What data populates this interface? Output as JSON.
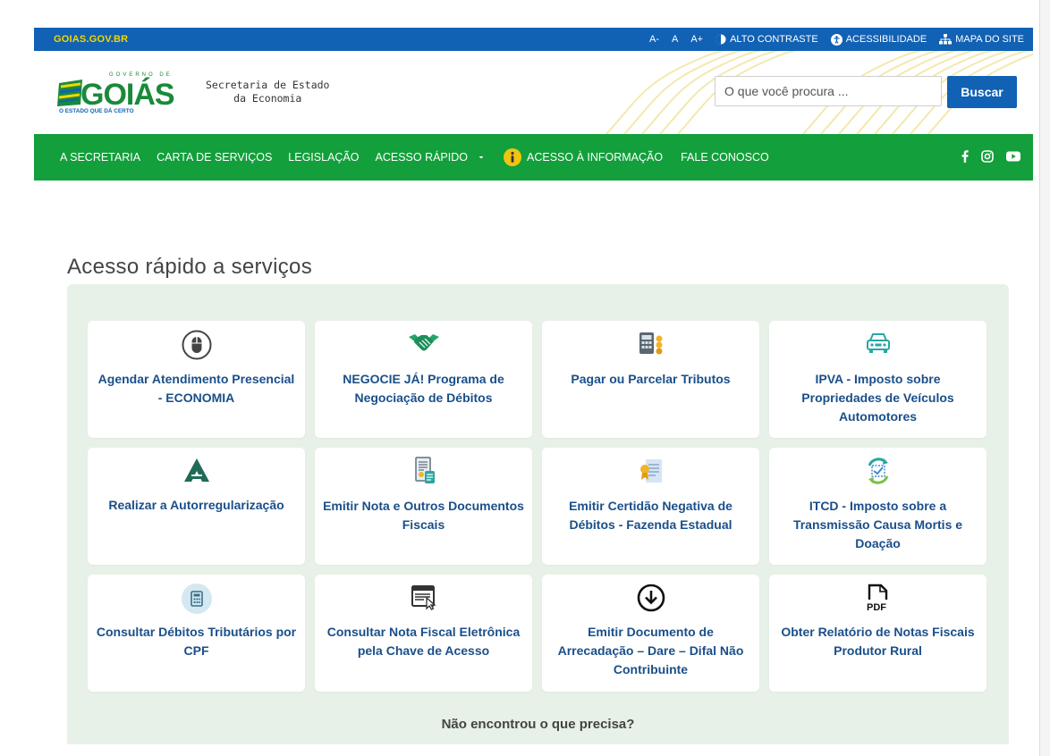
{
  "topbar": {
    "site": "GOIAS.GOV.BR",
    "font_decrease": "A-",
    "font_normal": "A",
    "font_increase": "A+",
    "contrast": "ALTO CONTRASTE",
    "accessibility": "ACESSIBILIDADE",
    "sitemap": "MAPA DO SITE"
  },
  "header": {
    "logo_top": "GOVERNO DE",
    "logo_main": "GOIÁS",
    "logo_tagline": "O ESTADO QUE DÁ CERTO",
    "secretaria_line1": "Secretaria de Estado",
    "secretaria_line2": "da Economia",
    "search_placeholder": "O que você procura ...",
    "search_button": "Buscar"
  },
  "nav": {
    "items": [
      {
        "label": "A SECRETARIA"
      },
      {
        "label": "CARTA DE SERVIÇOS"
      },
      {
        "label": "LEGISLAÇÃO"
      },
      {
        "label": "ACESSO RÁPIDO"
      },
      {
        "label": "ACESSO À INFORMAÇÃO"
      },
      {
        "label": "FALE CONOSCO"
      }
    ]
  },
  "services": {
    "title": "Acesso rápido a serviços",
    "cards": [
      {
        "icon": "mouse-icon",
        "label": "Agendar Atendimento Presencial - ECONOMIA"
      },
      {
        "icon": "handshake-icon",
        "label": "NEGOCIE JÁ! Programa de Negociação de Débitos"
      },
      {
        "icon": "calculator-coins-icon",
        "label": "Pagar ou Parcelar Tributos"
      },
      {
        "icon": "car-icon",
        "label": "IPVA - Imposto sobre Propriedades de Veículos Automotores"
      },
      {
        "icon": "autorregularizacao-logo-icon",
        "label": "Realizar a Autorregularização"
      },
      {
        "icon": "invoice-icon",
        "label": "Emitir Nota e Outros Documentos Fiscais"
      },
      {
        "icon": "certificate-icon",
        "label": "Emitir Certidão Negativa de Débitos - Fazenda Estadual"
      },
      {
        "icon": "transfer-icon",
        "label": "ITCD - Imposto sobre a Transmissão Causa Mortis e Doação"
      },
      {
        "icon": "calculator-icon",
        "label": "Consultar Débitos Tributários por CPF"
      },
      {
        "icon": "browser-click-icon",
        "label": "Consultar Nota Fiscal Eletrônica pela Chave de Acesso"
      },
      {
        "icon": "download-icon",
        "label": "Emitir Documento de Arrecadação – Dare – Difal Não Contribuinte"
      },
      {
        "icon": "pdf-icon",
        "label": "Obter Relatório de Notas Fiscais Produtor Rural"
      }
    ],
    "not_found": "Não encontrou o que precisa?"
  },
  "colors": {
    "blue": "#1161b4",
    "green": "#139f3b",
    "panel": "#e8f1e8",
    "card_text": "#1a4f8a"
  }
}
